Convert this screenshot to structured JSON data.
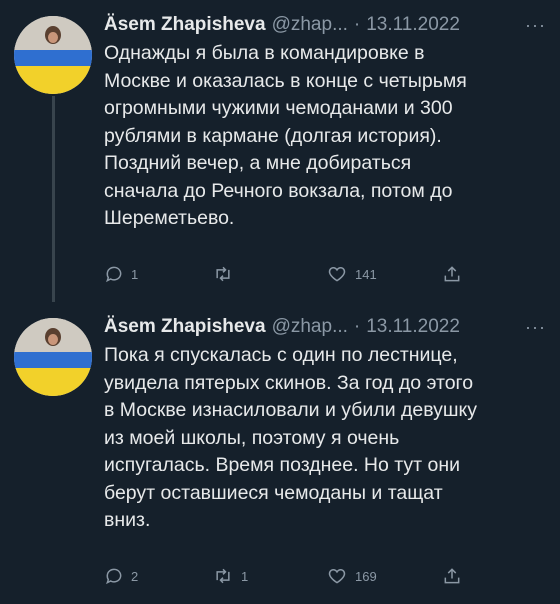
{
  "tweets": [
    {
      "author_name": "Äsem Zhapisheva",
      "handle": "@zhap...",
      "separator": "·",
      "date": "13.11.2022",
      "more": "···",
      "lines": [
        "Однажды я была в командировке в",
        "Москве и оказалась в конце с четырьмя",
        "огромными чужими чемоданами и 300",
        "рублями в кармане (долгая история).",
        "Поздний вечер, а мне добираться",
        "сначала до Речного вокзала, потом до",
        "Шереметьево."
      ],
      "replies": "1",
      "retweets": "",
      "likes": "141"
    },
    {
      "author_name": "Äsem Zhapisheva",
      "handle": "@zhap...",
      "separator": "·",
      "date": "13.11.2022",
      "more": "···",
      "lines": [
        "Пока я спускалась с один по лестнице,",
        "увидела пятерых скинов. За год до этого",
        "в Москве изнасиловали и убили девушку",
        "из моей школы, поэтому я очень",
        "испугалась. Время позднее. Но тут они",
        "берут оставшиеся чемоданы и тащат",
        "вниз."
      ],
      "replies": "2",
      "retweets": "1",
      "likes": "169"
    }
  ],
  "icons": {
    "reply": "reply-icon",
    "retweet": "retweet-icon",
    "like": "heart-icon",
    "share": "share-icon"
  },
  "colors": {
    "background": "#15202b",
    "text": "#e7e9ea",
    "secondary": "#8b98a5"
  }
}
